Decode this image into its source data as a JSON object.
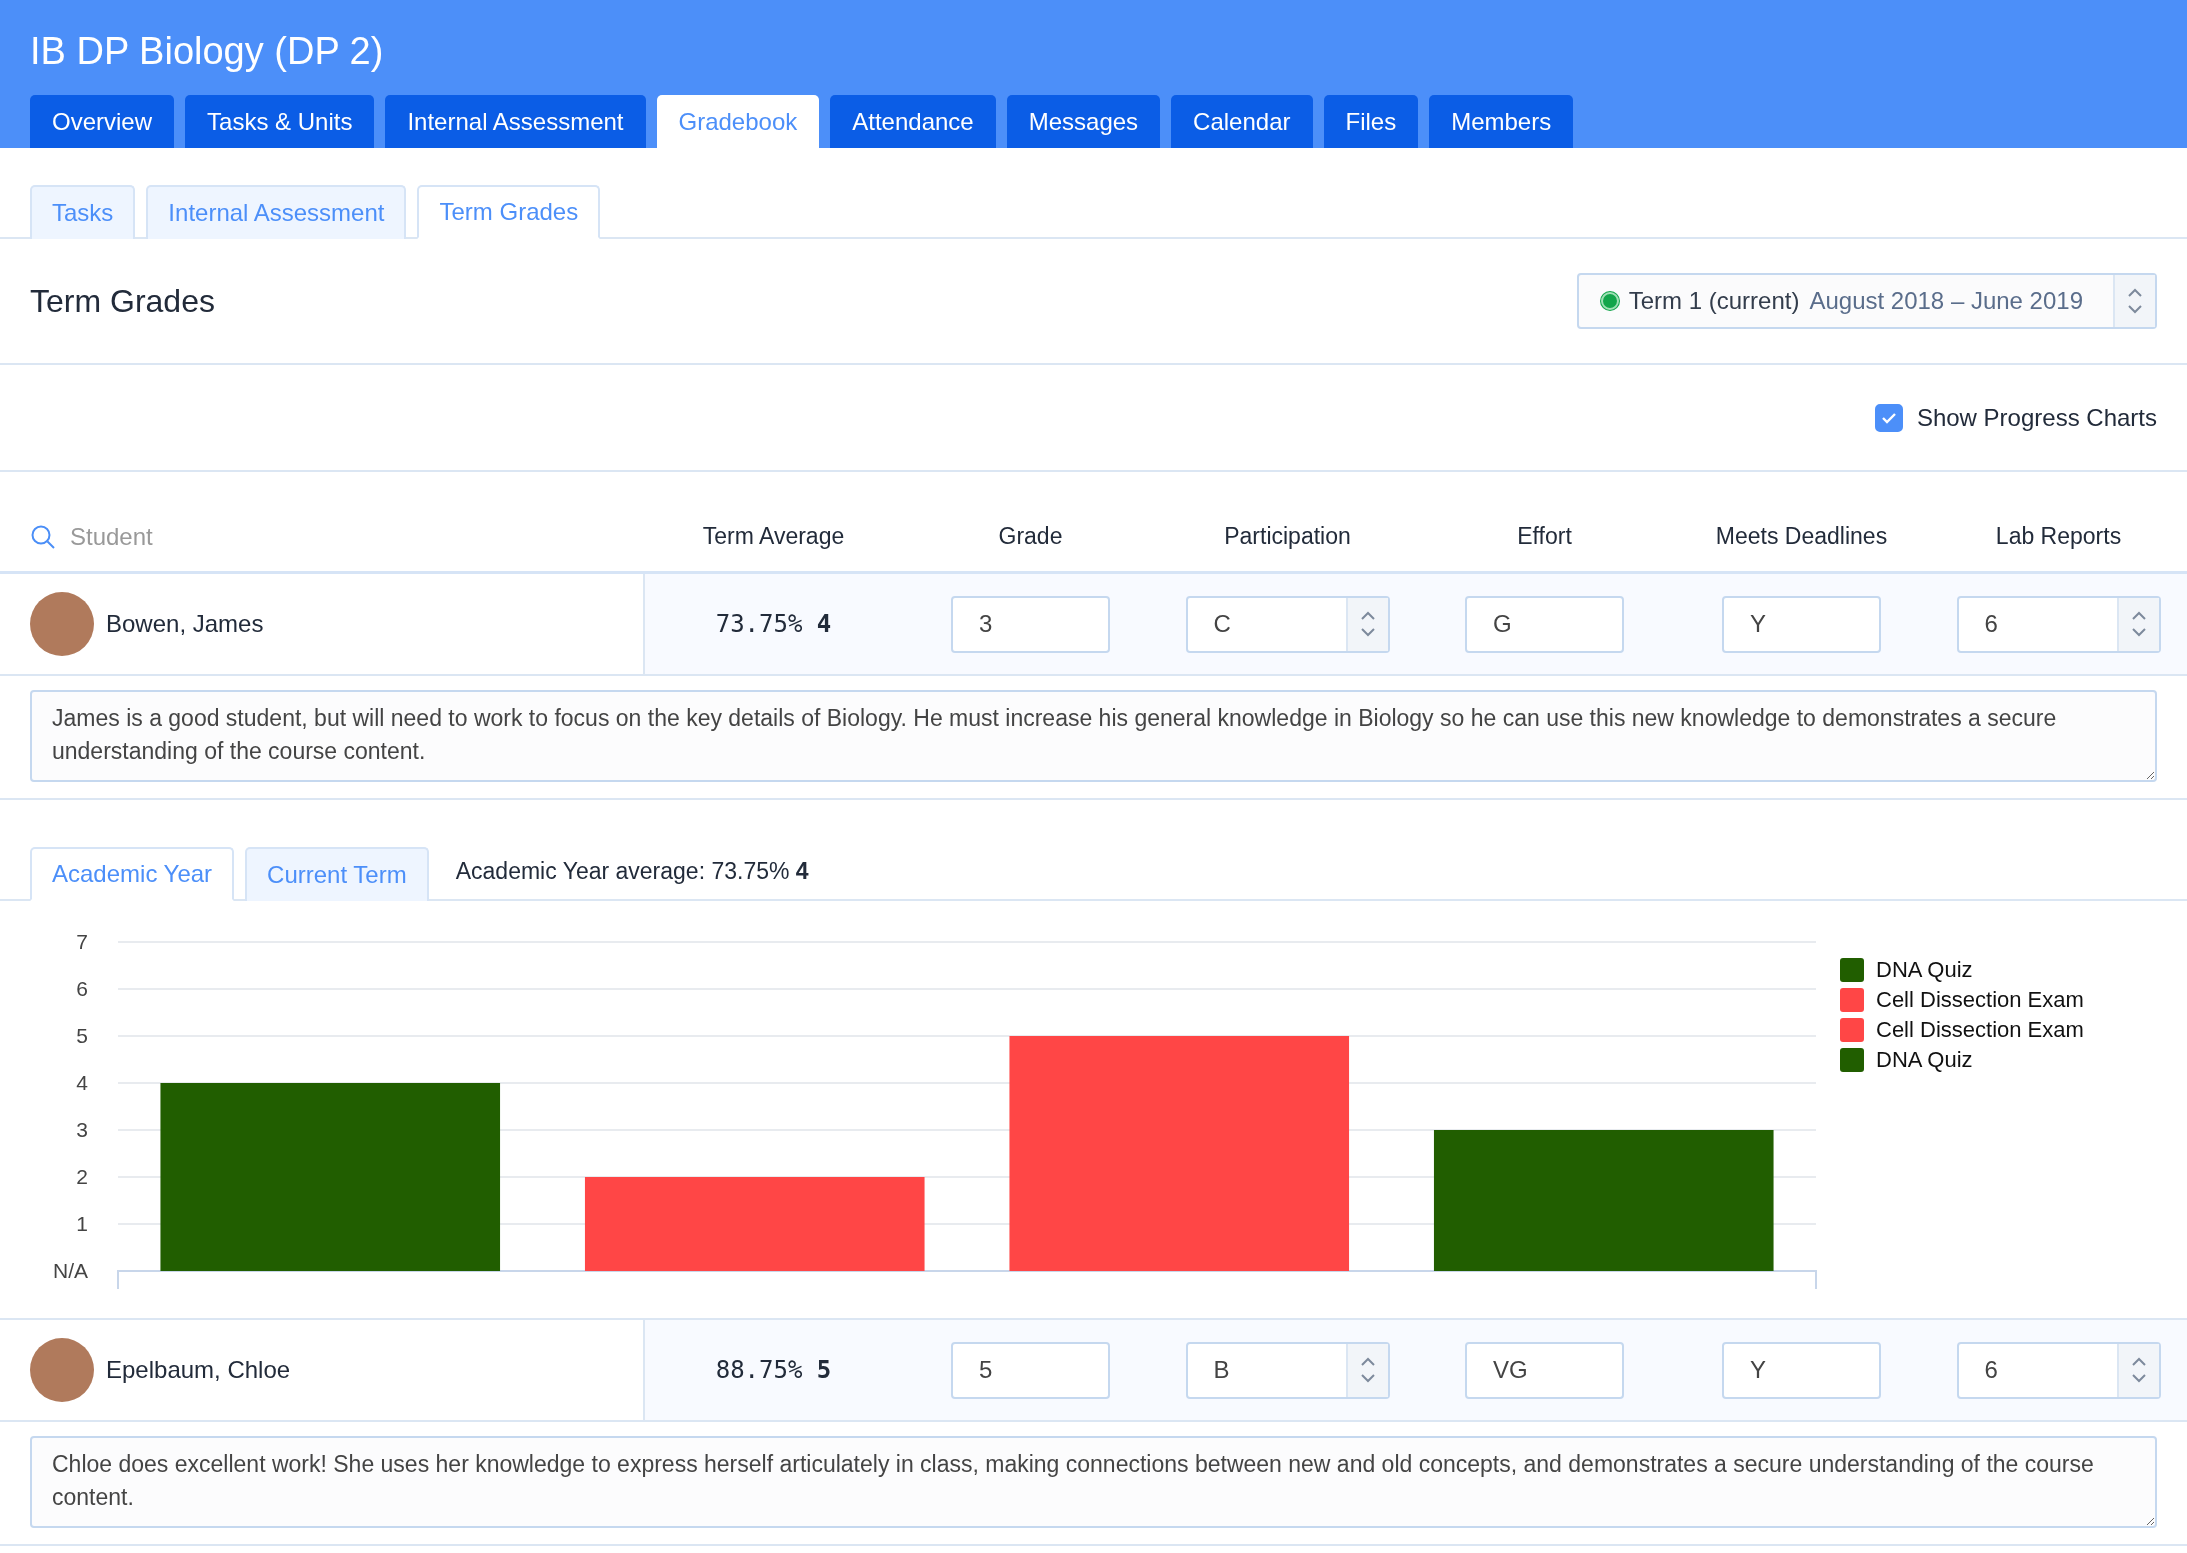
{
  "course": {
    "title": "IB DP Biology (DP 2)"
  },
  "tabs": [
    {
      "label": "Overview",
      "selected": false
    },
    {
      "label": "Tasks & Units",
      "selected": false
    },
    {
      "label": "Internal Assessment",
      "selected": false
    },
    {
      "label": "Gradebook",
      "selected": true
    },
    {
      "label": "Attendance",
      "selected": false
    },
    {
      "label": "Messages",
      "selected": false
    },
    {
      "label": "Calendar",
      "selected": false
    },
    {
      "label": "Files",
      "selected": false
    },
    {
      "label": "Members",
      "selected": false
    }
  ],
  "subtabs": [
    {
      "label": "Tasks",
      "selected": false
    },
    {
      "label": "Internal Assessment",
      "selected": false
    },
    {
      "label": "Term Grades",
      "selected": true
    }
  ],
  "page_title": "Term Grades",
  "term_select": {
    "term": "Term 1 (current)",
    "dates": "August 2018 – June 2019",
    "current": true
  },
  "show_progress_charts": {
    "label": "Show Progress Charts",
    "checked": true
  },
  "table": {
    "search": {
      "placeholder": "Student"
    },
    "columns": [
      "Term Average",
      "Grade",
      "Participation",
      "Effort",
      "Meets Deadlines",
      "Lab Reports"
    ]
  },
  "students": [
    {
      "name": "Bowen, James",
      "term_average": "73.75%",
      "term_grade": "4",
      "fields": [
        {
          "kind": "input",
          "value": "3"
        },
        {
          "kind": "spinner",
          "value": "C"
        },
        {
          "kind": "input",
          "value": "G"
        },
        {
          "kind": "input",
          "value": "Y"
        },
        {
          "kind": "spinner",
          "value": "6"
        }
      ],
      "comment": "James is a good student, but will need to work to focus on the key details of Biology. He must increase his general knowledge in Biology so he can use this new knowledge to demonstrates a secure understanding of the course content.",
      "progress": {
        "tabs": [
          {
            "label": "Academic Year",
            "selected": true
          },
          {
            "label": "Current Term",
            "selected": false
          }
        ],
        "average": "Academic Year average: 73.75% **4**",
        "chart_data": {
          "type": "bar",
          "ylim": [
            0,
            7
          ],
          "grid": true,
          "legend": "right",
          "yticks": [
            {
              "value": 0,
              "label": "N/A"
            },
            1,
            2,
            3,
            4,
            5,
            6,
            7
          ],
          "series": [
            {
              "name": "DNA Quiz",
              "color": "#215e00",
              "values": [
                4
              ]
            },
            {
              "name": "Cell Dissection Exam",
              "color": "#ff4646",
              "values": [
                2
              ]
            },
            {
              "name": "Cell Dissection Exam",
              "color": "#ff4646",
              "values": [
                5
              ]
            },
            {
              "name": "DNA Quiz",
              "color": "#215e00",
              "values": [
                3
              ]
            }
          ]
        }
      }
    },
    {
      "name": "Epelbaum, Chloe",
      "term_average": "88.75%",
      "term_grade": "5",
      "fields": [
        {
          "kind": "input",
          "value": "5"
        },
        {
          "kind": "spinner",
          "value": "B"
        },
        {
          "kind": "input",
          "value": "VG"
        },
        {
          "kind": "input",
          "value": "Y"
        },
        {
          "kind": "spinner",
          "value": "6"
        }
      ],
      "comment": "Chloe does excellent work! She uses her knowledge to express herself articulately in class, making connections between new and old concepts, and demonstrates a secure understanding of the course content."
    }
  ]
}
